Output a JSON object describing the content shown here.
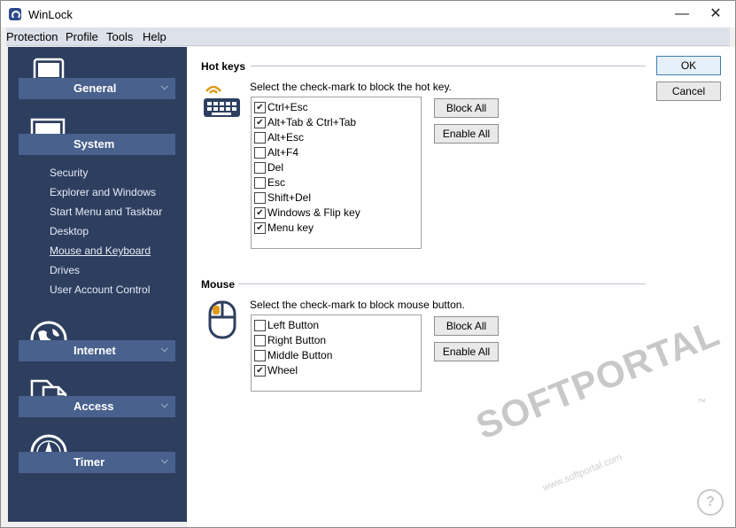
{
  "window": {
    "title": "WinLock",
    "minimize": "—",
    "close": "✕"
  },
  "menu": [
    "Protection",
    "Profile",
    "Tools",
    "Help"
  ],
  "sidebar": {
    "categories": [
      {
        "label": "General",
        "icon": "ipod-icon"
      },
      {
        "label": "System",
        "icon": "computer-icon"
      },
      {
        "label": "Internet",
        "icon": "globe-icon"
      },
      {
        "label": "Access",
        "icon": "documents-icon"
      },
      {
        "label": "Timer",
        "icon": "clock-icon"
      }
    ],
    "system_items": [
      "Security",
      "Explorer and Windows",
      "Start Menu and Taskbar",
      "Desktop",
      "Mouse and Keyboard",
      "Drives",
      "User Account Control"
    ],
    "active_item": "Mouse and Keyboard"
  },
  "hotkeys": {
    "title": "Hot keys",
    "description": "Select the check-mark to block the hot key.",
    "items": [
      {
        "label": "Ctrl+Esc",
        "checked": "✔"
      },
      {
        "label": "Alt+Tab & Ctrl+Tab",
        "checked": "✔"
      },
      {
        "label": "Alt+Esc",
        "checked": ""
      },
      {
        "label": "Alt+F4",
        "checked": ""
      },
      {
        "label": "Del",
        "checked": ""
      },
      {
        "label": "Esc",
        "checked": ""
      },
      {
        "label": "Shift+Del",
        "checked": ""
      },
      {
        "label": "Windows & Flip key",
        "checked": "✔"
      },
      {
        "label": "Menu key",
        "checked": "✔"
      }
    ],
    "block_all": "Block All",
    "enable_all": "Enable All"
  },
  "mouse": {
    "title": "Mouse",
    "description": "Select the check-mark to block mouse button.",
    "items": [
      {
        "label": "Left Button",
        "checked": ""
      },
      {
        "label": "Right Button",
        "checked": ""
      },
      {
        "label": "Middle Button",
        "checked": ""
      },
      {
        "label": "Wheel",
        "checked": "✔"
      }
    ],
    "block_all": "Block All",
    "enable_all": "Enable All"
  },
  "buttons": {
    "ok": "OK",
    "cancel": "Cancel"
  },
  "watermark": {
    "text": "SOFTPORTAL",
    "tm": "™",
    "url": "www.softportal.com",
    "help": "?"
  },
  "colors": {
    "sidebar": "#2d3e5f",
    "category_bar": "#48618d",
    "accent_orange": "#e09a1a"
  }
}
